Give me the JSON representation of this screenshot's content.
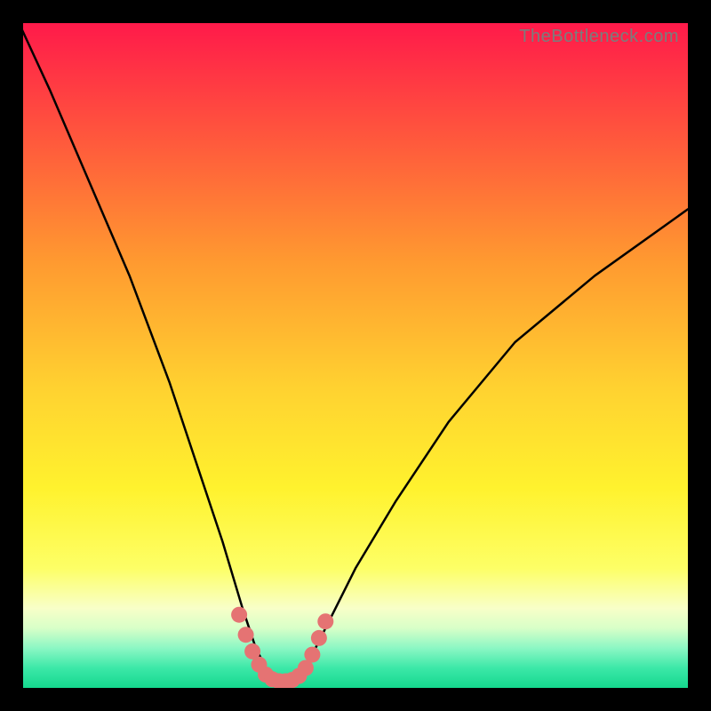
{
  "watermark": "TheBottleneck.com",
  "chart_data": {
    "type": "line",
    "title": "",
    "xlabel": "",
    "ylabel": "",
    "xlim": [
      0,
      100
    ],
    "ylim": [
      0,
      100
    ],
    "series": [
      {
        "name": "bottleneck-curve",
        "x": [
          -2,
          4,
          10,
          16,
          22,
          26,
          30,
          33,
          34,
          35,
          36,
          37,
          38,
          39,
          40,
          41,
          42,
          43,
          44,
          46,
          50,
          56,
          64,
          74,
          86,
          100
        ],
        "y": [
          103,
          90,
          76,
          62,
          46,
          34,
          22,
          12,
          9,
          6,
          4,
          2,
          1,
          1,
          1,
          1,
          2,
          4,
          6,
          10,
          18,
          28,
          40,
          52,
          62,
          72
        ]
      }
    ],
    "highlight_points": {
      "name": "optimal-zone",
      "color": "#e57373",
      "x": [
        32.5,
        33.5,
        34.5,
        35.5,
        36.5,
        37.5,
        38.5,
        39.5,
        40.5,
        41.5,
        42.5,
        43.5,
        44.5,
        45.5
      ],
      "y": [
        11,
        8,
        5.5,
        3.5,
        2,
        1.3,
        1,
        1,
        1.2,
        1.8,
        3,
        5,
        7.5,
        10
      ]
    }
  }
}
